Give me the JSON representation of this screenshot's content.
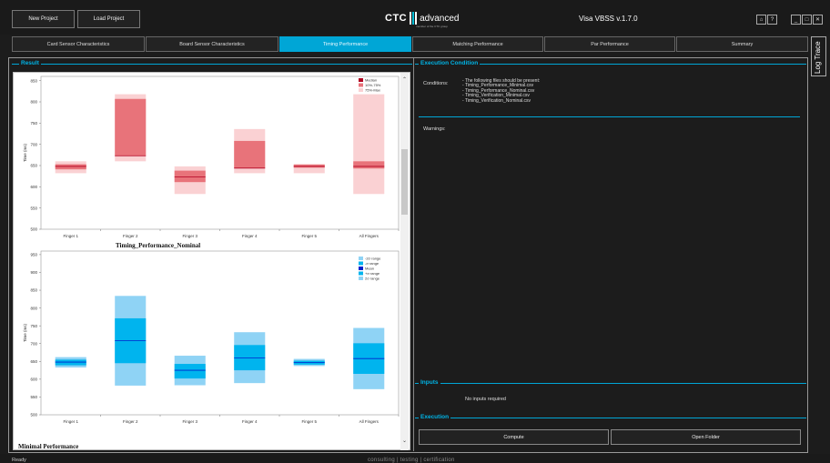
{
  "header": {
    "new_project": "New Project",
    "load_project": "Load Project",
    "logo_main": "CTC",
    "logo_word": "advanced",
    "logo_sub": "member of the CTC group",
    "version": "Visa VBSS v.1.7.0",
    "window_controls": [
      "_",
      "□",
      "✕"
    ],
    "help_controls": [
      "⌂",
      "?"
    ]
  },
  "tabs": [
    {
      "label": "Card Sensor Characteristics",
      "active": false
    },
    {
      "label": "Board Sensor Characteristics",
      "active": false
    },
    {
      "label": "Timing Performance",
      "active": true
    },
    {
      "label": "Matching Performance",
      "active": false
    },
    {
      "label": "Par Performance",
      "active": false
    },
    {
      "label": "Summary",
      "active": false
    }
  ],
  "log_trace": "Log Trace",
  "result": {
    "title": "Result",
    "chart2_title": "Timing_Performance_Nominal",
    "chart3_title": "Minimal Performance"
  },
  "execution_condition": {
    "title": "Execution Condition",
    "conditions_label": "Conditions:",
    "conditions_lines": [
      "- The following files should be present:",
      "- Timing_Performance_Minimal.csv",
      "- Timing_Performance_Nominal.csv",
      "- Timing_Verification_Minimal.csv",
      "- Timing_Verification_Nominal.csv"
    ],
    "warnings_label": "Warnings:"
  },
  "inputs": {
    "title": "Inputs",
    "text": "No inputs required"
  },
  "execution": {
    "title": "Execution",
    "compute": "Compute",
    "open_folder": "Open Folder"
  },
  "status": {
    "text": "Ready",
    "footer": "consulting | testing | certification"
  },
  "colors": {
    "accent": "#00a6d6",
    "median": "#b00020",
    "q_25_75": "#e8737a",
    "q_75_max": "#fad1d3",
    "mean": "#0022cc",
    "sigma1": "#00b4ee",
    "sigma2": "#8fd3f5"
  },
  "chart_data": [
    {
      "type": "box",
      "title": "",
      "ylabel": "Time (ms)",
      "ylim": [
        500,
        860
      ],
      "yticks": [
        500,
        550,
        600,
        650,
        700,
        750,
        800,
        850
      ],
      "categories": [
        "Finger 1",
        "Finger 2",
        "Finger 3",
        "Finger 4",
        "Finger 5",
        "All Fingers"
      ],
      "legend": [
        "Median",
        "10%-75%",
        "75%-Max"
      ],
      "legend_position": "top-right",
      "series": [
        {
          "category": "Finger 1",
          "low": 632,
          "q_lower": 641,
          "q_upper": 653,
          "max": 660,
          "median": 648
        },
        {
          "category": "Finger 2",
          "low": 660,
          "q_lower": 673,
          "q_upper": 807,
          "max": 818,
          "median": 673
        },
        {
          "category": "Finger 3",
          "low": 583,
          "q_lower": 611,
          "q_upper": 638,
          "max": 648,
          "median": 623
        },
        {
          "category": "Finger 4",
          "low": 632,
          "q_lower": 644,
          "q_upper": 708,
          "max": 736,
          "median": 644
        },
        {
          "category": "Finger 5",
          "low": 632,
          "q_lower": 645,
          "q_upper": 652,
          "max": 654,
          "median": 648
        },
        {
          "category": "All Fingers",
          "low": 583,
          "q_lower": 643,
          "q_upper": 660,
          "max": 818,
          "median": 648
        }
      ]
    },
    {
      "type": "box",
      "title": "Timing_Performance_Nominal",
      "ylabel": "Time (ms)",
      "ylim": [
        500,
        960
      ],
      "yticks": [
        500,
        550,
        600,
        650,
        700,
        750,
        800,
        850,
        900,
        950
      ],
      "categories": [
        "Finger 1",
        "Finger 2",
        "Finger 3",
        "Finger 4",
        "Finger 5",
        "All Fingers"
      ],
      "legend": [
        "-2σ range",
        "-σ range",
        "Mean",
        "+σ range",
        "2σ range"
      ],
      "legend_position": "top-right",
      "series": [
        {
          "category": "Finger 1",
          "minus2": 633,
          "minus1": 639,
          "mean": 648,
          "plus1": 655,
          "plus2": 662
        },
        {
          "category": "Finger 2",
          "minus2": 582,
          "minus1": 645,
          "mean": 708,
          "plus1": 771,
          "plus2": 834
        },
        {
          "category": "Finger 3",
          "minus2": 583,
          "minus1": 602,
          "mean": 625,
          "plus1": 643,
          "plus2": 666
        },
        {
          "category": "Finger 4",
          "minus2": 589,
          "minus1": 625,
          "mean": 660,
          "plus1": 696,
          "plus2": 732
        },
        {
          "category": "Finger 5",
          "minus2": 637,
          "minus1": 641,
          "mean": 647,
          "plus1": 652,
          "plus2": 657
        },
        {
          "category": "All Fingers",
          "minus2": 572,
          "minus1": 615,
          "mean": 658,
          "plus1": 701,
          "plus2": 744
        }
      ]
    }
  ]
}
